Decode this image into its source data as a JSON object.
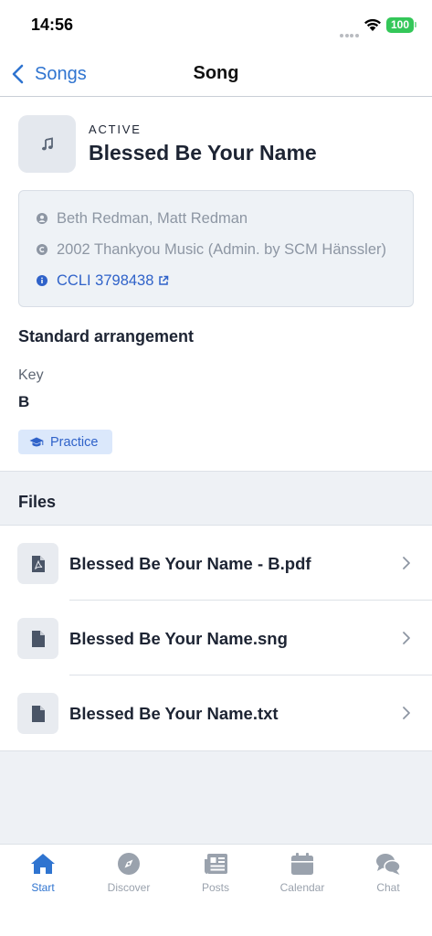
{
  "status_bar": {
    "time": "14:56",
    "battery": "100"
  },
  "nav": {
    "back_label": "Songs",
    "title": "Song"
  },
  "song": {
    "status": "ACTIVE",
    "title": "Blessed Be Your Name",
    "authors": "Beth Redman, Matt Redman",
    "copyright": "2002 Thankyou Music (Admin. by SCM Hänssler)",
    "ccli": "CCLI 3798438"
  },
  "arrangement": {
    "title": "Standard arrangement",
    "key_label": "Key",
    "key_value": "B",
    "practice_label": "Practice"
  },
  "files": {
    "header": "Files",
    "items": [
      {
        "name": "Blessed Be Your Name - B.pdf",
        "icon": "pdf-file-icon"
      },
      {
        "name": "Blessed Be Your Name.sng",
        "icon": "file-icon"
      },
      {
        "name": "Blessed Be Your Name.txt",
        "icon": "file-icon"
      }
    ]
  },
  "tabs": [
    {
      "label": "Start",
      "icon": "home-icon",
      "active": true
    },
    {
      "label": "Discover",
      "icon": "compass-icon",
      "active": false
    },
    {
      "label": "Posts",
      "icon": "newspaper-icon",
      "active": false
    },
    {
      "label": "Calendar",
      "icon": "calendar-icon",
      "active": false
    },
    {
      "label": "Chat",
      "icon": "chat-icon",
      "active": false
    }
  ],
  "colors": {
    "accent": "#2f74d0",
    "link": "#2f62c9",
    "battery": "#34c759",
    "inactive_tab": "#9aa2ad"
  }
}
